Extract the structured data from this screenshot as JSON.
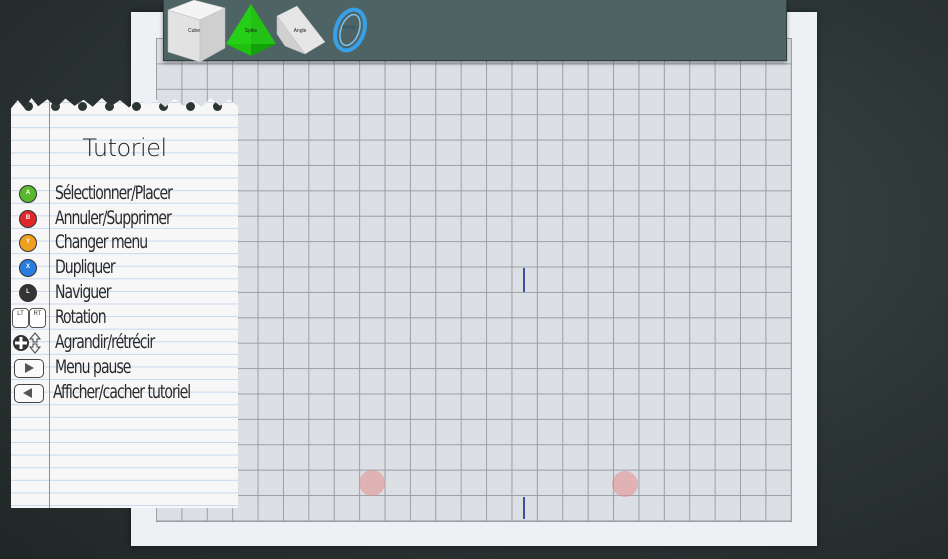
{
  "toolbar": {
    "items": [
      {
        "label": "Cube",
        "icon": "cube-icon",
        "color": "#e6e6e6"
      },
      {
        "label": "Spike",
        "icon": "spike-icon",
        "color": "#22cc11"
      },
      {
        "label": "Angle",
        "icon": "angle-icon",
        "color": "#dedede"
      },
      {
        "label": "Portal",
        "icon": "portal-icon",
        "color": "#3aa0e6"
      }
    ]
  },
  "tutorial": {
    "title": "Tutoriel",
    "rows": [
      {
        "button": "A",
        "color": "#5ab82e",
        "label": "Sélectionner/Placer"
      },
      {
        "button": "B",
        "color": "#e0282a",
        "label": "Annuler/Supprimer"
      },
      {
        "button": "Y",
        "color": "#f0a020",
        "label": "Changer menu"
      },
      {
        "button": "X",
        "color": "#2a7de0",
        "label": "Dupliquer"
      },
      {
        "button": "L",
        "color": "#333333",
        "label": "Naviguer"
      },
      {
        "button": "LT RT",
        "color": "#ffffff",
        "label": "Rotation",
        "left": "LT",
        "right": "RT"
      },
      {
        "button": "dpad",
        "color": "#333333",
        "label": "Agrandir/rétrécir"
      },
      {
        "button": "start",
        "color": "#ffffff",
        "label": "Menu pause"
      },
      {
        "button": "back",
        "color": "#ffffff",
        "label": "Afficher/cacher tutoriel"
      }
    ]
  },
  "colors": {
    "board": "#dcdfe3",
    "gridline": "#9aa0a8",
    "toolbar": "#4e6464",
    "marker": "#3b4fa0",
    "spawn": "#e68c8c"
  }
}
